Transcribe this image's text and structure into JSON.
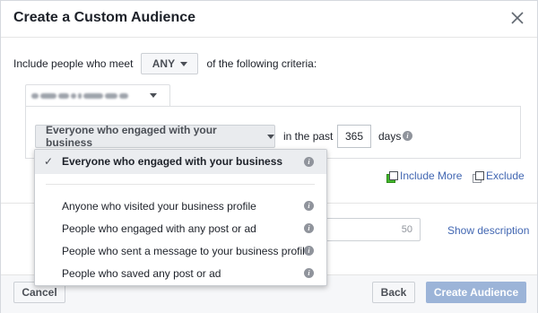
{
  "dialog": {
    "title": "Create a Custom Audience"
  },
  "criteria": {
    "prefix": "Include people who meet",
    "match_value": "ANY",
    "suffix": "of the following criteria:"
  },
  "rule": {
    "engagement_value": "Everyone who engaged with your business",
    "in_the_past_label": "in the past",
    "days_value": "365",
    "days_label": "days"
  },
  "links": {
    "include_more": "Include More",
    "exclude": "Exclude",
    "show_description": "Show description"
  },
  "name_field": {
    "char_count": "50"
  },
  "dropdown": {
    "options": [
      {
        "label": "Everyone who engaged with your business",
        "selected": true
      },
      {
        "label": "Anyone who visited your business profile",
        "selected": false
      },
      {
        "label": "People who engaged with any post or ad",
        "selected": false
      },
      {
        "label": "People who sent a message to your business profile",
        "selected": false
      },
      {
        "label": "People who saved any post or ad",
        "selected": false
      }
    ]
  },
  "footer": {
    "cancel_label": "Cancel",
    "back_label": "Back",
    "create_label": "Create Audience"
  },
  "colors": {
    "link": "#4267b2",
    "primary_disabled": "#9cb4d8",
    "selected_row": "#ebedf0"
  },
  "icons": {
    "close": "close-icon",
    "caret": "caret-down-icon",
    "info": "info-icon",
    "check": "checkmark-icon",
    "include": "include-more-icon",
    "exclude": "exclude-icon"
  }
}
